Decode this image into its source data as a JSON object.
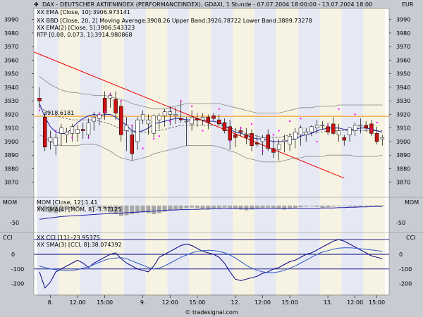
{
  "header": {
    "icon": "chart-icon",
    "title": "DAX  - DEUTSCHER AKTIENINDEX (PERFORMANCEINDEX), GDAXI, 1 Stunde - 07.07.2004 18:00:00 - 13.07.2004 18:00",
    "currency": "EUR"
  },
  "legend": {
    "ema": "XX EMA [Close, 10]:3906.973141",
    "bbd": "XX BBD [Close, 20, 2] Moving Average:3908.26 Upper Band:3926.78722 Lower Band:3889.73278",
    "ema2": "XX EMA(2) [Close, 5]:3906.543323",
    "rtp": "RTP [0.08, 0.073, 1]:3914.980868",
    "mom": "MOM [Close, 12]:1.41",
    "sma_mom": "XX SMA(4) [MOM, 8]:-3.37125",
    "cci": "XX CCI [11]:-23.95375",
    "sma_cci": "XX SMA(3) [CCI, 8]:38.074392"
  },
  "price_marker": "3918.6181",
  "panel_labels": {
    "mom_left": "MOM",
    "mom_right": "MOM",
    "cci_left": "CCI",
    "cci_right": "CCI"
  },
  "footer": "© tradesignal.com",
  "colors": {
    "up": "#ffffff",
    "down": "#cc1111",
    "ema": "#2222aa",
    "band": "#888888",
    "rtp": "#ff00ff",
    "trend": "#ee0000",
    "hline": "#ff8c00",
    "mom_bar": "#a8a8a8",
    "cci": "#000080"
  },
  "chart_data": [
    {
      "type": "candlestick",
      "title": "DAX  - DEUTSCHER AKTIENINDEX (PERFORMANCEINDEX), GDAXI, 1 Stunde",
      "ylim": [
        3860,
        3995
      ],
      "yticks": [
        3870,
        3880,
        3890,
        3900,
        3910,
        3920,
        3930,
        3940,
        3950,
        3960,
        3970,
        3980,
        3990
      ],
      "xticks": [
        "8.",
        "12:00",
        "15:00",
        "9.",
        "12:00",
        "15:00",
        "12.",
        "12:00",
        "15:00",
        "13.",
        "12:00",
        "15:00"
      ],
      "ohlc": [
        [
          3932,
          3940,
          3925,
          3930
        ],
        [
          3918,
          3921,
          3893,
          3896
        ],
        [
          3900,
          3908,
          3894,
          3903
        ],
        [
          3897,
          3906,
          3890,
          3903
        ],
        [
          3906,
          3913,
          3897,
          3910
        ],
        [
          3905,
          3910,
          3899,
          3907
        ],
        [
          3906,
          3913,
          3900,
          3911
        ],
        [
          3906,
          3912,
          3900,
          3909
        ],
        [
          3909,
          3914,
          3902,
          3908
        ],
        [
          3905,
          3917,
          3902,
          3914
        ],
        [
          3915,
          3922,
          3908,
          3918
        ],
        [
          3917,
          3922,
          3912,
          3920
        ],
        [
          3932,
          3937,
          3916,
          3921
        ],
        [
          3932,
          3936,
          3925,
          3934
        ],
        [
          3931,
          3937,
          3916,
          3921
        ],
        [
          3926,
          3930,
          3900,
          3905
        ],
        [
          3908,
          3918,
          3893,
          3912
        ],
        [
          3905,
          3912,
          3886,
          3891
        ],
        [
          3900,
          3918,
          3894,
          3916
        ],
        [
          3916,
          3923,
          3913,
          3920
        ],
        [
          3913,
          3920,
          3905,
          3916
        ],
        [
          3906,
          3920,
          3903,
          3919
        ],
        [
          3916,
          3921,
          3909,
          3919
        ],
        [
          3919,
          3924,
          3911,
          3922
        ],
        [
          3920,
          3926,
          3912,
          3922
        ],
        [
          3919,
          3925,
          3913,
          3920
        ],
        [
          3917,
          3930,
          3914,
          3916
        ],
        [
          3915,
          3918,
          3897,
          3915
        ],
        [
          3913,
          3923,
          3908,
          3918
        ],
        [
          3917,
          3921,
          3911,
          3916
        ],
        [
          3916,
          3921,
          3912,
          3918
        ],
        [
          3918,
          3920,
          3909,
          3914
        ],
        [
          3919,
          3921,
          3915,
          3917
        ],
        [
          3916,
          3920,
          3912,
          3913
        ],
        [
          3914,
          3917,
          3906,
          3908
        ],
        [
          3911,
          3916,
          3894,
          3901
        ],
        [
          3905,
          3910,
          3896,
          3903
        ],
        [
          3908,
          3911,
          3904,
          3907
        ],
        [
          3905,
          3910,
          3898,
          3903
        ],
        [
          3906,
          3909,
          3893,
          3897
        ],
        [
          3899,
          3905,
          3896,
          3898
        ],
        [
          3900,
          3905,
          3890,
          3903
        ],
        [
          3905,
          3909,
          3893,
          3895
        ],
        [
          3895,
          3902,
          3888,
          3892
        ],
        [
          3894,
          3902,
          3886,
          3898
        ],
        [
          3900,
          3905,
          3892,
          3901
        ],
        [
          3898,
          3906,
          3893,
          3904
        ],
        [
          3902,
          3910,
          3895,
          3907
        ],
        [
          3905,
          3912,
          3897,
          3910
        ],
        [
          3905,
          3910,
          3900,
          3907
        ],
        [
          3907,
          3912,
          3904,
          3911
        ],
        [
          3910,
          3916,
          3906,
          3912
        ],
        [
          3912,
          3915,
          3909,
          3912
        ],
        [
          3911,
          3914,
          3905,
          3907
        ],
        [
          3913,
          3918,
          3905,
          3906
        ],
        [
          3905,
          3913,
          3900,
          3908
        ],
        [
          3903,
          3905,
          3897,
          3901
        ],
        [
          3905,
          3910,
          3900,
          3910
        ],
        [
          3908,
          3914,
          3904,
          3912
        ],
        [
          3912,
          3917,
          3906,
          3912
        ],
        [
          3912,
          3915,
          3907,
          3910
        ],
        [
          3913,
          3916,
          3904,
          3906
        ],
        [
          3906,
          3911,
          3898,
          3900
        ],
        [
          3902,
          3905,
          3897,
          3903
        ]
      ],
      "ema": [
        3928,
        3918,
        3911,
        3907,
        3906,
        3906,
        3910,
        3914,
        3917,
        3919,
        3920,
        3919,
        3920,
        3920,
        3918,
        3915,
        3912,
        3908,
        3907,
        3908,
        3910,
        3913,
        3914,
        3915,
        3916,
        3917,
        3917,
        3916,
        3916,
        3916,
        3916,
        3915,
        3915,
        3914,
        3912,
        3909,
        3907,
        3906,
        3905,
        3903,
        3902,
        3902,
        3901,
        3900,
        3900,
        3900,
        3901,
        3902,
        3904,
        3905,
        3906,
        3908,
        3909,
        3910,
        3910,
        3910,
        3909,
        3909,
        3909,
        3910,
        3910,
        3909,
        3908,
        3907
      ],
      "bb_upper": [
        3948,
        3945,
        3942,
        3940,
        3938,
        3937,
        3936,
        3936,
        3935,
        3935,
        3934,
        3934,
        3934,
        3933,
        3932,
        3931,
        3930,
        3928,
        3927,
        3926,
        3925,
        3924,
        3924,
        3924,
        3925,
        3926,
        3927,
        3928,
        3928,
        3928,
        3928,
        3928,
        3928,
        3928,
        3927,
        3926,
        3925,
        3924,
        3923,
        3922,
        3921,
        3921,
        3921,
        3921,
        3921,
        3922,
        3923,
        3924,
        3925,
        3925,
        3925,
        3926,
        3926,
        3926,
        3926,
        3927,
        3927,
        3927,
        3927,
        3927,
        3927,
        3927,
        3927,
        3927
      ],
      "bb_lower": [
        3905,
        3903,
        3900,
        3898,
        3897,
        3897,
        3897,
        3897,
        3898,
        3898,
        3898,
        3897,
        3895,
        3893,
        3890,
        3888,
        3887,
        3886,
        3887,
        3888,
        3889,
        3891,
        3892,
        3893,
        3894,
        3895,
        3896,
        3897,
        3897,
        3897,
        3897,
        3897,
        3897,
        3896,
        3895,
        3893,
        3892,
        3890,
        3888,
        3887,
        3886,
        3885,
        3885,
        3885,
        3885,
        3886,
        3887,
        3888,
        3888,
        3889,
        3889,
        3889,
        3889,
        3890,
        3890,
        3890,
        3890,
        3890,
        3889,
        3889,
        3889,
        3889,
        3889,
        3890
      ],
      "bb_ma": [
        3925,
        3923,
        3921,
        3919,
        3918,
        3917,
        3916,
        3916,
        3916,
        3916,
        3916,
        3915,
        3914,
        3913,
        3911,
        3909,
        3908,
        3907,
        3907,
        3907,
        3907,
        3908,
        3908,
        3909,
        3910,
        3911,
        3912,
        3912,
        3912,
        3912,
        3912,
        3912,
        3912,
        3912,
        3911,
        3910,
        3909,
        3907,
        3906,
        3905,
        3904,
        3903,
        3903,
        3903,
        3903,
        3904,
        3905,
        3906,
        3906,
        3907,
        3907,
        3907,
        3907,
        3908,
        3908,
        3908,
        3908,
        3908,
        3908,
        3908,
        3908,
        3908,
        3908,
        3908
      ],
      "rtp_points": [
        [
          0,
          3923
        ],
        [
          3,
          3908
        ],
        [
          6,
          3903
        ],
        [
          9,
          3903
        ],
        [
          11,
          3920
        ],
        [
          12,
          3922
        ],
        [
          13,
          3935
        ],
        [
          15,
          3930
        ],
        [
          17,
          3912
        ],
        [
          19,
          3895
        ],
        [
          21,
          3902
        ],
        [
          22,
          3904
        ],
        [
          24,
          3915
        ],
        [
          26,
          3930
        ],
        [
          28,
          3926
        ],
        [
          30,
          3908
        ],
        [
          33,
          3924
        ],
        [
          35,
          3900
        ],
        [
          37,
          3910
        ],
        [
          39,
          3913
        ],
        [
          41,
          3893
        ],
        [
          43,
          3905
        ],
        [
          44,
          3908
        ],
        [
          46,
          3915
        ],
        [
          48,
          3917
        ],
        [
          51,
          3900
        ],
        [
          53,
          3912
        ],
        [
          55,
          3924
        ],
        [
          58,
          3920
        ],
        [
          61,
          3909
        ],
        [
          62,
          3914
        ]
      ],
      "trendline": [
        [
          3966,
          -1
        ],
        [
          3873,
          56
        ]
      ],
      "hline": 3918.6181
    },
    {
      "type": "bar",
      "title": "MOM [Close, 12]",
      "ylim": [
        -70,
        20
      ],
      "yticks": [
        -50
      ],
      "values": [
        -12,
        -18,
        -20,
        -22,
        -18,
        -12,
        -8,
        -5,
        -3,
        -2,
        -5,
        -8,
        -10,
        -20,
        -25,
        -30,
        -28,
        -25,
        -22,
        -20,
        -22,
        -25,
        -22,
        -18,
        -15,
        -12,
        -10,
        -8,
        -6,
        -8,
        -10,
        -12,
        -10,
        -8,
        -6,
        -8,
        -10,
        -12,
        -14,
        -12,
        -10,
        -8,
        -6,
        -8,
        -10,
        -12,
        -10,
        -8,
        -5,
        -3,
        -2,
        -4,
        -6,
        -5,
        -3,
        -2,
        -1,
        -3,
        -5,
        -4,
        -2,
        -1,
        1,
        1
      ],
      "sma": [
        -40,
        -38,
        -36,
        -34,
        -32,
        -31,
        -30,
        -29,
        -28,
        -27,
        -26,
        -25,
        -24,
        -24,
        -23,
        -22,
        -21,
        -20,
        -19,
        -18,
        -17,
        -16,
        -15,
        -14,
        -13,
        -13,
        -12,
        -12,
        -11,
        -11,
        -10,
        -10,
        -9,
        -9,
        -9,
        -9,
        -8,
        -8,
        -8,
        -8,
        -8,
        -8,
        -8,
        -8,
        -8,
        -8,
        -8,
        -8,
        -8,
        -8,
        -8,
        -8,
        -7,
        -7,
        -7,
        -6,
        -6,
        -5,
        -5,
        -4,
        -4,
        -3,
        -3,
        -3
      ]
    },
    {
      "type": "line",
      "title": "CCI [11]",
      "ylim": [
        -260,
        130
      ],
      "yticks": [
        -200,
        -100,
        0
      ],
      "cci": [
        -120,
        -230,
        -190,
        -120,
        -100,
        -80,
        -60,
        -40,
        -60,
        -90,
        -60,
        -40,
        -20,
        0,
        10,
        -30,
        -60,
        -80,
        -100,
        -110,
        -120,
        -80,
        -20,
        0,
        20,
        40,
        60,
        70,
        60,
        40,
        20,
        10,
        0,
        -20,
        -60,
        -120,
        -170,
        -180,
        -170,
        -160,
        -150,
        -130,
        -120,
        -100,
        -90,
        -70,
        -50,
        -40,
        -20,
        0,
        10,
        30,
        50,
        70,
        90,
        100,
        90,
        70,
        50,
        30,
        10,
        -10,
        -20,
        -30
      ],
      "sma": [
        -80,
        -90,
        -100,
        -105,
        -110,
        -112,
        -110,
        -105,
        -95,
        -85,
        -70,
        -55,
        -40,
        -30,
        -25,
        -22,
        -30,
        -45,
        -60,
        -75,
        -90,
        -100,
        -95,
        -80,
        -60,
        -40,
        -20,
        -5,
        10,
        20,
        25,
        28,
        25,
        20,
        10,
        -5,
        -25,
        -50,
        -75,
        -95,
        -110,
        -120,
        -125,
        -125,
        -120,
        -110,
        -95,
        -80,
        -60,
        -40,
        -20,
        0,
        15,
        25,
        35,
        42,
        45,
        45,
        42,
        38,
        34,
        30,
        25,
        20
      ],
      "lines": [
        -100,
        0,
        100
      ]
    }
  ]
}
